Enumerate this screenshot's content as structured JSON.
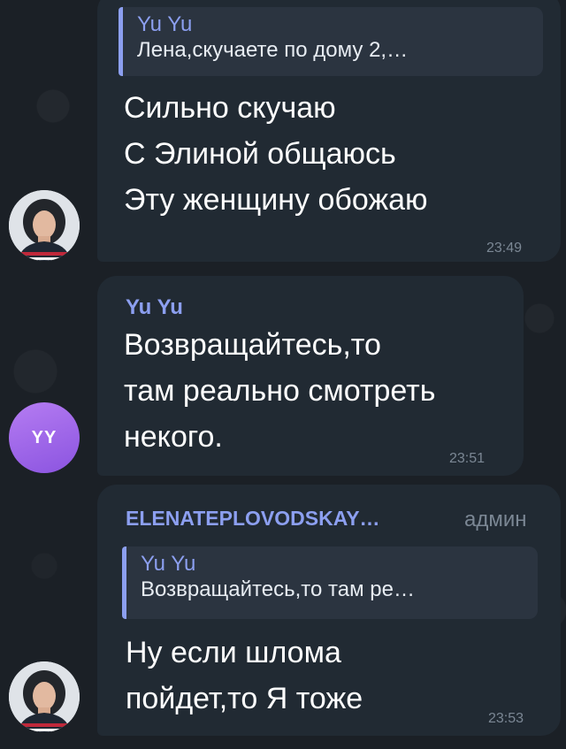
{
  "messages": [
    {
      "reply": {
        "name": "Yu Yu",
        "text": "Лена,скучаете по дому 2,…"
      },
      "lines": [
        "Сильно скучаю",
        "С Элиной общаюсь",
        "Эту женщину обожаю"
      ],
      "time": "23:49"
    },
    {
      "sender": "Yu Yu",
      "lines": [
        "Возвращайтесь,то",
        "там реально смотреть",
        "некого."
      ],
      "time": "23:51",
      "avatar": "YY"
    },
    {
      "sender": "ELENATEPLOVODSKAY…",
      "role": "админ",
      "reply": {
        "name": "Yu Yu",
        "text": "Возвращайтесь,то там ре…"
      },
      "lines": [
        "Ну если шлома",
        "пойдет,то Я тоже"
      ],
      "time": "23:53"
    }
  ],
  "colors": {
    "background": "#1b2026",
    "bubble": "#212a33",
    "accent": "#8c9ff0",
    "avatar_purple": "#a26ae8"
  },
  "icons": {
    "photo_avatar": "user-photo-avatar"
  }
}
